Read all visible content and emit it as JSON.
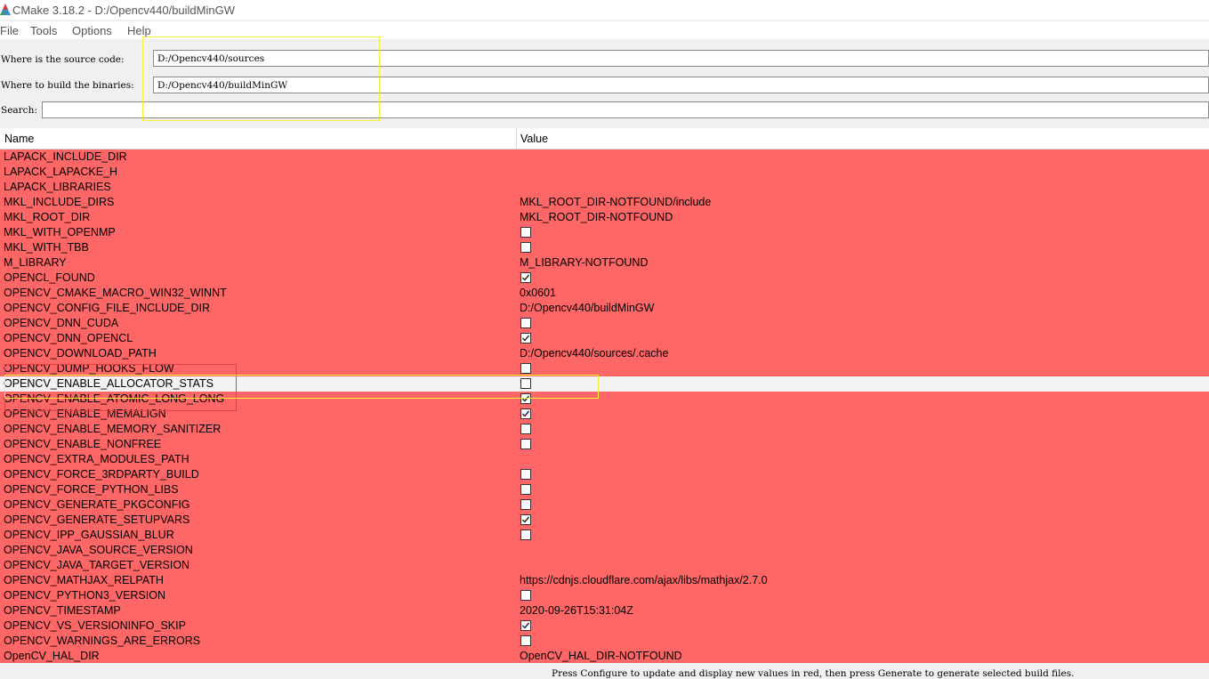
{
  "window": {
    "title": "CMake 3.18.2 - D:/Opencv440/buildMinGW",
    "icon": "cmake-triangle-icon"
  },
  "menu": [
    "File",
    "Tools",
    "Options",
    "Help"
  ],
  "source": {
    "label": "Where is the source code:",
    "value": "D:/Opencv440/sources"
  },
  "build": {
    "label": "Where to build the binaries:",
    "value": "D:/Opencv440/buildMinGW"
  },
  "search": {
    "label": "Search:",
    "value": ""
  },
  "table": {
    "headers": {
      "name": "Name",
      "value": "Value"
    },
    "rows": [
      {
        "name": "LAPACK_INCLUDE_DIR",
        "value": ""
      },
      {
        "name": "LAPACK_LAPACKE_H",
        "value": ""
      },
      {
        "name": "LAPACK_LIBRARIES",
        "value": ""
      },
      {
        "name": "MKL_INCLUDE_DIRS",
        "value": "MKL_ROOT_DIR-NOTFOUND/include"
      },
      {
        "name": "MKL_ROOT_DIR",
        "value": "MKL_ROOT_DIR-NOTFOUND"
      },
      {
        "name": "MKL_WITH_OPENMP",
        "checkbox": true,
        "checked": false
      },
      {
        "name": "MKL_WITH_TBB",
        "checkbox": true,
        "checked": false
      },
      {
        "name": "M_LIBRARY",
        "value": "M_LIBRARY-NOTFOUND"
      },
      {
        "name": "OPENCL_FOUND",
        "checkbox": true,
        "checked": true
      },
      {
        "name": "OPENCV_CMAKE_MACRO_WIN32_WINNT",
        "value": "0x0601"
      },
      {
        "name": "OPENCV_CONFIG_FILE_INCLUDE_DIR",
        "value": "D:/Opencv440/buildMinGW"
      },
      {
        "name": "OPENCV_DNN_CUDA",
        "checkbox": true,
        "checked": false
      },
      {
        "name": "OPENCV_DNN_OPENCL",
        "checkbox": true,
        "checked": true
      },
      {
        "name": "OPENCV_DOWNLOAD_PATH",
        "value": "D:/Opencv440/sources/.cache"
      },
      {
        "name": "OPENCV_DUMP_HOOKS_FLOW",
        "checkbox": true,
        "checked": false
      },
      {
        "name": "OPENCV_ENABLE_ALLOCATOR_STATS",
        "checkbox": true,
        "checked": false,
        "selected": true
      },
      {
        "name": "OPENCV_ENABLE_ATOMIC_LONG_LONG",
        "checkbox": true,
        "checked": true
      },
      {
        "name": "OPENCV_ENABLE_MEMALIGN",
        "checkbox": true,
        "checked": true
      },
      {
        "name": "OPENCV_ENABLE_MEMORY_SANITIZER",
        "checkbox": true,
        "checked": false
      },
      {
        "name": "OPENCV_ENABLE_NONFREE",
        "checkbox": true,
        "checked": false
      },
      {
        "name": "OPENCV_EXTRA_MODULES_PATH",
        "value": ""
      },
      {
        "name": "OPENCV_FORCE_3RDPARTY_BUILD",
        "checkbox": true,
        "checked": false
      },
      {
        "name": "OPENCV_FORCE_PYTHON_LIBS",
        "checkbox": true,
        "checked": false
      },
      {
        "name": "OPENCV_GENERATE_PKGCONFIG",
        "checkbox": true,
        "checked": false
      },
      {
        "name": "OPENCV_GENERATE_SETUPVARS",
        "checkbox": true,
        "checked": true
      },
      {
        "name": "OPENCV_IPP_GAUSSIAN_BLUR",
        "checkbox": true,
        "checked": false
      },
      {
        "name": "OPENCV_JAVA_SOURCE_VERSION",
        "value": ""
      },
      {
        "name": "OPENCV_JAVA_TARGET_VERSION",
        "value": ""
      },
      {
        "name": "OPENCV_MATHJAX_RELPATH",
        "value": "https://cdnjs.cloudflare.com/ajax/libs/mathjax/2.7.0"
      },
      {
        "name": "OPENCV_PYTHON3_VERSION",
        "checkbox": true,
        "checked": false
      },
      {
        "name": "OPENCV_TIMESTAMP",
        "value": "2020-09-26T15:31:04Z"
      },
      {
        "name": "OPENCV_VS_VERSIONINFO_SKIP",
        "checkbox": true,
        "checked": true
      },
      {
        "name": "OPENCV_WARNINGS_ARE_ERRORS",
        "checkbox": true,
        "checked": false
      },
      {
        "name": "OpenCV_HAL_DIR",
        "value": "OpenCV_HAL_DIR-NOTFOUND"
      }
    ]
  },
  "status": "Press Configure to update and display new values in red, then press Generate to generate selected build files.",
  "colors": {
    "new_entry_red": "#ff6666",
    "selected_row": "#f2f2f2",
    "annotation_yellow": "#f2ee3a",
    "annotation_red": "#e04040"
  }
}
